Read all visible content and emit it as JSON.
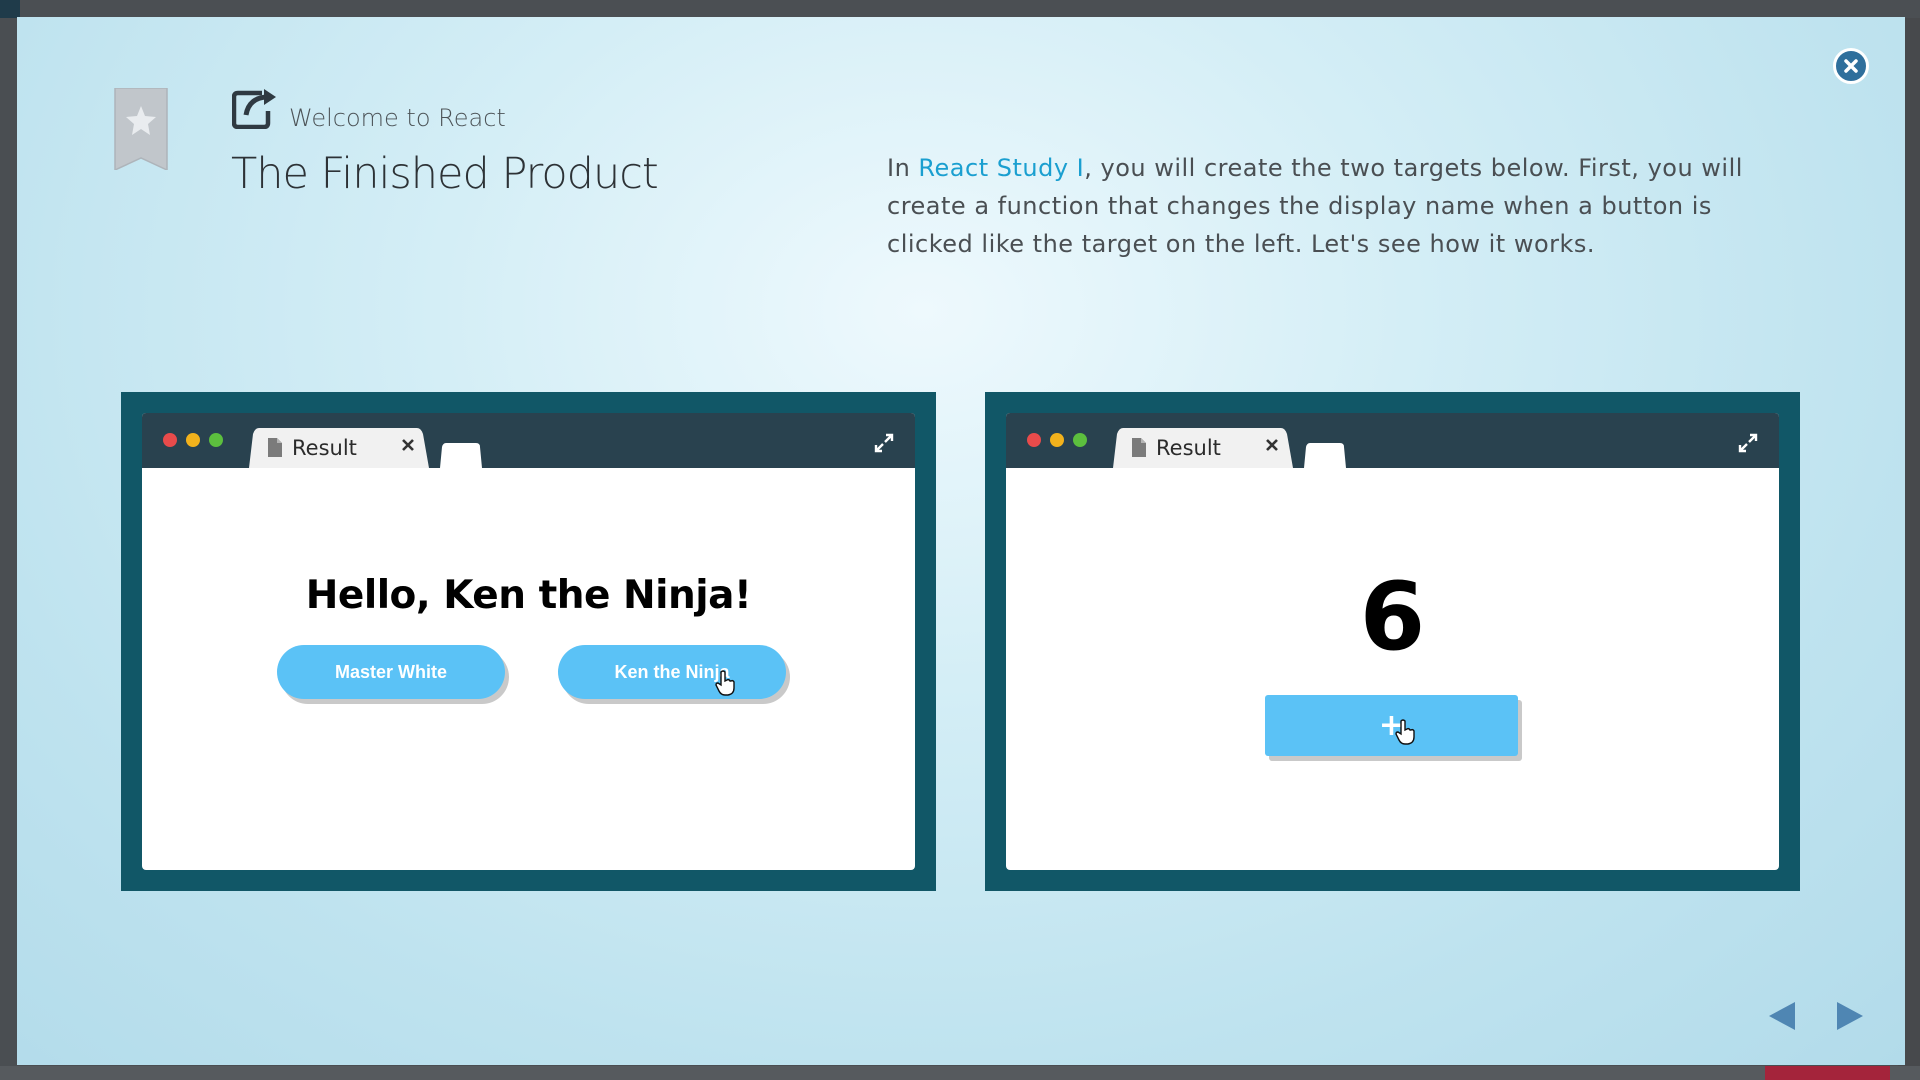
{
  "header": {
    "subtitle": "Welcome to React",
    "title": "The Finished Product"
  },
  "description": {
    "prefix": "In ",
    "link_text": "React Study I",
    "suffix": ", you will create the two targets below. First, you will create a function that changes the display name when a button is clicked like the target on the left. Let's see how it works."
  },
  "demos": [
    {
      "tab_label": "Result",
      "heading": "Hello, Ken the Ninja!",
      "buttons": [
        "Master White",
        "Ken the Ninja"
      ]
    },
    {
      "tab_label": "Result",
      "count": "6",
      "button": "+"
    }
  ],
  "colors": {
    "modal_bg": "#c8e8f2",
    "frame": "#115767",
    "chrome": "#29424f",
    "button": "#5bc2f6",
    "link": "#1a9fd0",
    "close": "#2f6f9c",
    "nav_arrow": "#4f86b3"
  },
  "icons": {
    "close": "close-icon",
    "bookmark": "bookmark-star-icon",
    "header": "external-link-icon",
    "expand": "expand-icon",
    "prev": "arrow-left-icon",
    "next": "arrow-right-icon"
  }
}
